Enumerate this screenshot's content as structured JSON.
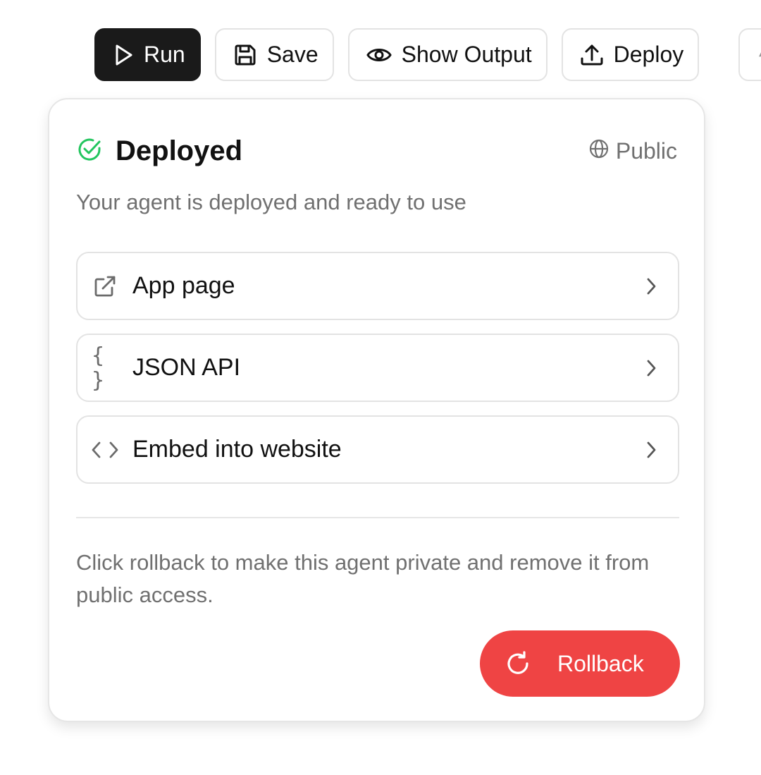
{
  "toolbar": {
    "run_label": "Run",
    "save_label": "Save",
    "show_output_label": "Show Output",
    "deploy_label": "Deploy"
  },
  "deploy_panel": {
    "status_title": "Deployed",
    "visibility_label": "Public",
    "subtitle": "Your agent is deployed and ready to use",
    "options": [
      {
        "label": "App page",
        "icon": "external-link-icon"
      },
      {
        "label": "JSON API",
        "icon": "braces-icon",
        "icon_text": "{ }"
      },
      {
        "label": "Embed into website",
        "icon": "code-icon"
      }
    ],
    "rollback_note": "Click rollback to make this agent private and remove it from public access.",
    "rollback_label": "Rollback"
  },
  "colors": {
    "primary_button_bg": "#1a1a1a",
    "success_green": "#22c55e",
    "rollback_red": "#ef4444",
    "muted_text": "#707070"
  }
}
